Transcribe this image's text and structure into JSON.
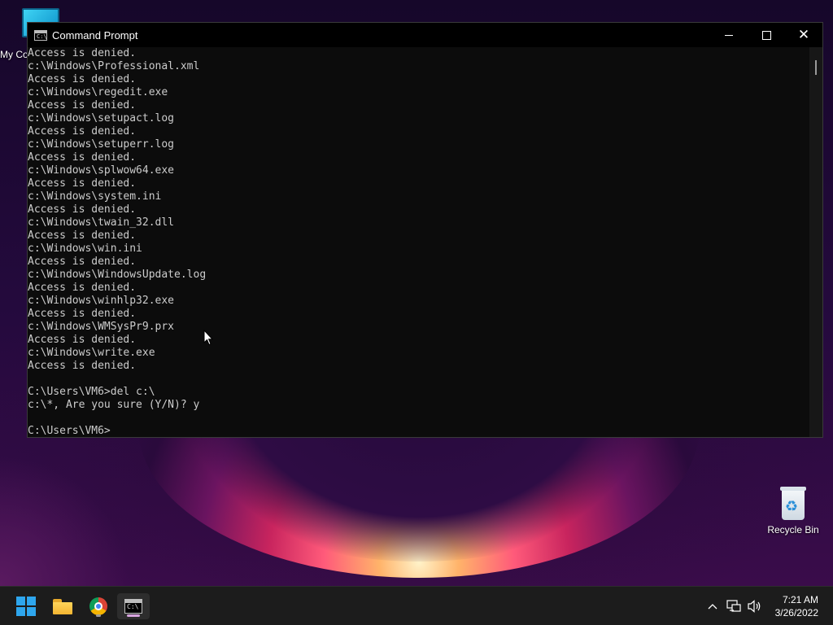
{
  "desktop": {
    "icons": [
      {
        "label": "My Co",
        "icon": "computer-icon"
      },
      {
        "label": "Recycle Bin",
        "icon": "recycle-bin-icon"
      }
    ]
  },
  "window": {
    "title": "Command Prompt",
    "controls": {
      "minimize": "minimize-icon",
      "maximize": "maximize-icon",
      "close": "close-icon"
    },
    "console_lines": [
      "Access is denied.",
      "c:\\Windows\\Professional.xml",
      "Access is denied.",
      "c:\\Windows\\regedit.exe",
      "Access is denied.",
      "c:\\Windows\\setupact.log",
      "Access is denied.",
      "c:\\Windows\\setuperr.log",
      "Access is denied.",
      "c:\\Windows\\splwow64.exe",
      "Access is denied.",
      "c:\\Windows\\system.ini",
      "Access is denied.",
      "c:\\Windows\\twain_32.dll",
      "Access is denied.",
      "c:\\Windows\\win.ini",
      "Access is denied.",
      "c:\\Windows\\WindowsUpdate.log",
      "Access is denied.",
      "c:\\Windows\\winhlp32.exe",
      "Access is denied.",
      "c:\\Windows\\WMSysPr9.prx",
      "Access is denied.",
      "c:\\Windows\\write.exe",
      "Access is denied.",
      "",
      "C:\\Users\\VM6>del c:\\",
      "c:\\*, Are you sure (Y/N)? y",
      "",
      "C:\\Users\\VM6>"
    ]
  },
  "taskbar": {
    "apps": [
      {
        "name": "Start",
        "icon": "windows-start-icon",
        "active": false
      },
      {
        "name": "File Explorer",
        "icon": "folder-icon",
        "active": false
      },
      {
        "name": "Google Chrome",
        "icon": "chrome-icon",
        "active": false
      },
      {
        "name": "Command Prompt",
        "icon": "terminal-icon",
        "active": true
      }
    ],
    "tray": {
      "icons": [
        "chevron-up-icon",
        "network-icon",
        "volume-icon"
      ],
      "time": "7:21 AM",
      "date": "3/26/2022"
    }
  }
}
